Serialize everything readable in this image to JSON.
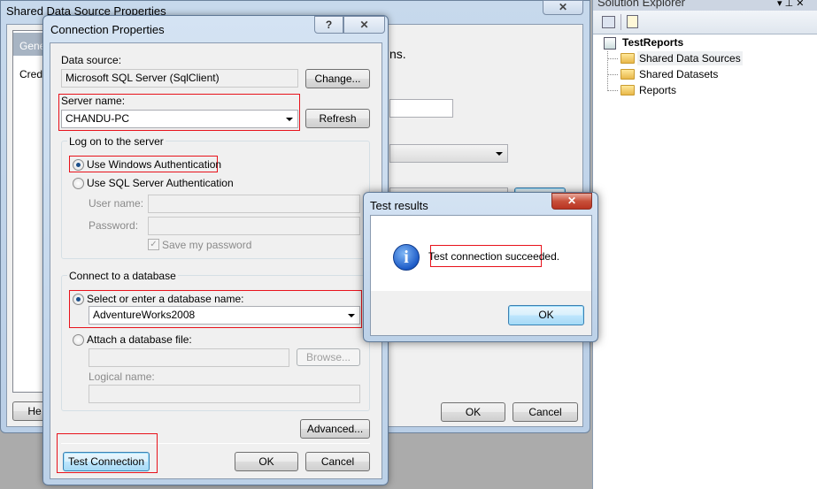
{
  "back_window": {
    "title": "Shared Data Source Properties",
    "tab_general": "Gene",
    "tab_credentials": "Cred",
    "text_fragment": "ns.",
    "help_fragment": "He",
    "ok": "OK",
    "cancel": "Cancel"
  },
  "connection": {
    "title": "Connection Properties",
    "help": "?",
    "close": "✕",
    "data_source_label": "Data source:",
    "data_source_value": "Microsoft SQL Server (SqlClient)",
    "change": "Change...",
    "server_label": "Server name:",
    "server_value": "CHANDU-PC",
    "refresh": "Refresh",
    "logon_group": "Log on to the server",
    "windows_auth": "Use Windows Authentication",
    "sql_auth": "Use SQL Server Authentication",
    "username_label": "User name:",
    "password_label": "Password:",
    "save_password": "Save my password",
    "db_group": "Connect to a database",
    "select_db": "Select or enter a database name:",
    "db_value": "AdventureWorks2008",
    "attach_db": "Attach a database file:",
    "browse": "Browse...",
    "logical_name": "Logical name:",
    "advanced": "Advanced...",
    "test_connection": "Test Connection",
    "ok": "OK",
    "cancel": "Cancel"
  },
  "test_results": {
    "title": "Test results",
    "close": "✕",
    "message": "Test connection succeeded.",
    "ok": "OK",
    "icon": "info-icon"
  },
  "solution_explorer": {
    "title": "Solution Explorer",
    "project": "TestReports",
    "items": [
      "Shared Data Sources",
      "Shared Datasets",
      "Reports"
    ]
  },
  "colors": {
    "highlight": "#e8121b",
    "accent": "#3c7fb1"
  }
}
